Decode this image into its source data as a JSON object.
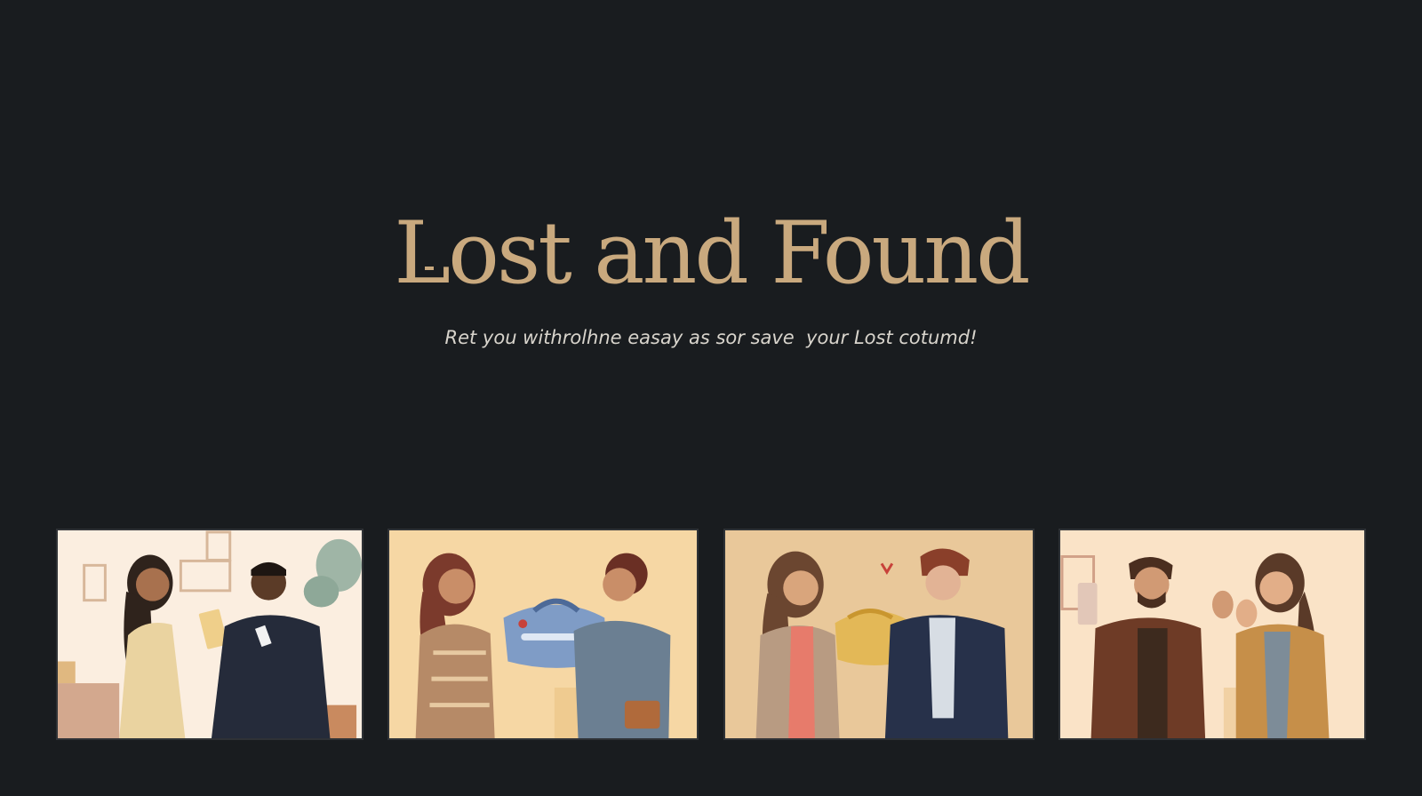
{
  "hero": {
    "title": "Lost and Found",
    "subtitle": "Ret you withrolhne easay as sor save  your Lost cotumd!"
  },
  "illustrations": [
    {
      "scene": "woman handing document to man",
      "background": "#fbeee0"
    },
    {
      "scene": "woman handing blue bag to woman",
      "background": "#f6d7a4"
    },
    {
      "scene": "woman handing yellow bag to man",
      "background": "#e9c89a"
    },
    {
      "scene": "man and woman greeting",
      "background": "#fae3c7"
    }
  ],
  "colors": {
    "background": "#191c1f",
    "title": "#c9a97e",
    "subtitle": "#d8d4cc"
  }
}
